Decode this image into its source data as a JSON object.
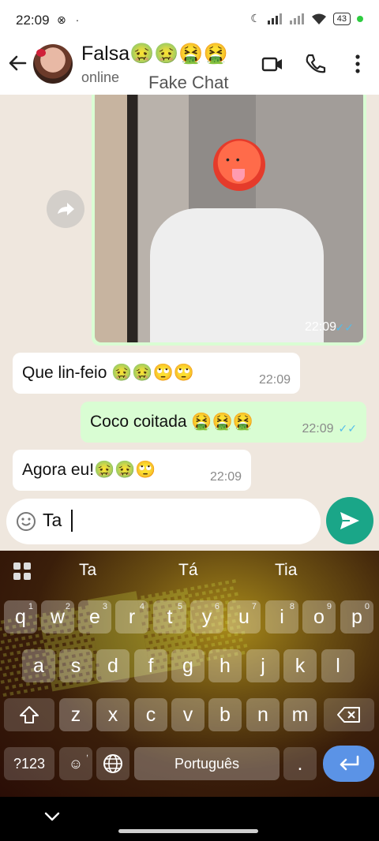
{
  "status_bar": {
    "time": "22:09",
    "icons_left": "⊗ ·",
    "battery": "43"
  },
  "header": {
    "name": "Falsa🤢🤢🤮🤮",
    "status": "online",
    "watermark": "Fake Chat"
  },
  "messages": [
    {
      "type": "image",
      "direction": "out",
      "time": "22:09",
      "ticks": "✓✓"
    },
    {
      "type": "text",
      "direction": "in",
      "text": "Que lin-feio 🤢🤢🙄🙄",
      "time": "22:09"
    },
    {
      "type": "text",
      "direction": "out",
      "text": "Coco coitada 🤮🤮🤮",
      "time": "22:09",
      "ticks": "✓✓"
    },
    {
      "type": "text",
      "direction": "in",
      "text": "Agora eu!🤢🤢🙄",
      "time": "22:09"
    }
  ],
  "composer": {
    "value": "Ta"
  },
  "keyboard": {
    "suggestions": [
      "Ta",
      "Tá",
      "Tia"
    ],
    "row1": [
      [
        "q",
        "1"
      ],
      [
        "w",
        "2"
      ],
      [
        "e",
        "3"
      ],
      [
        "r",
        "4"
      ],
      [
        "t",
        "5"
      ],
      [
        "y",
        "6"
      ],
      [
        "u",
        "7"
      ],
      [
        "i",
        "8"
      ],
      [
        "o",
        "9"
      ],
      [
        "p",
        "0"
      ]
    ],
    "row2": [
      "a",
      "s",
      "d",
      "f",
      "g",
      "h",
      "j",
      "k",
      "l"
    ],
    "row3": [
      "z",
      "x",
      "c",
      "v",
      "b",
      "n",
      "m"
    ],
    "symbols_key": "?123",
    "emoji_key": "☺",
    "comma_key": ",",
    "space_label": "Português",
    "period_key": "."
  },
  "colors": {
    "chat_bg": "#efe7de",
    "outgoing_bubble": "#d9fdd3",
    "incoming_bubble": "#ffffff",
    "send_button": "#1aa688",
    "read_ticks": "#53bdeb"
  }
}
